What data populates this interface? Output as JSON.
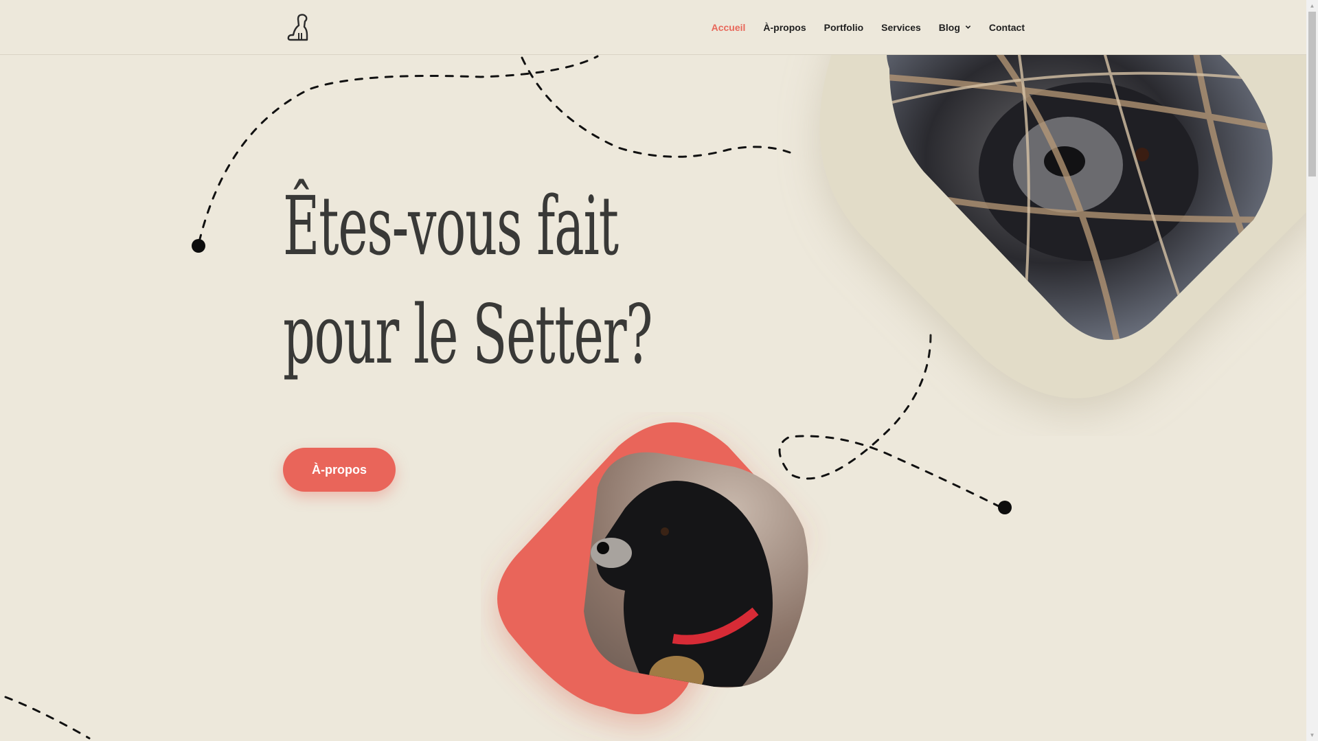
{
  "header": {
    "logo": "dog-logo-icon",
    "nav": [
      {
        "label": "Accueil",
        "active": true
      },
      {
        "label": "À-propos",
        "active": false
      },
      {
        "label": "Portfolio",
        "active": false
      },
      {
        "label": "Services",
        "active": false
      },
      {
        "label": "Blog",
        "active": false,
        "has_dropdown": true
      },
      {
        "label": "Contact",
        "active": false
      }
    ]
  },
  "hero": {
    "title_line1": "Êtes-vous fait",
    "title_line2": "pour le Setter?",
    "cta_label": "À-propos"
  },
  "colors": {
    "background": "#ede8db",
    "accent": "#e9655a",
    "text": "#393937",
    "nav_text": "#1f1f1f"
  }
}
